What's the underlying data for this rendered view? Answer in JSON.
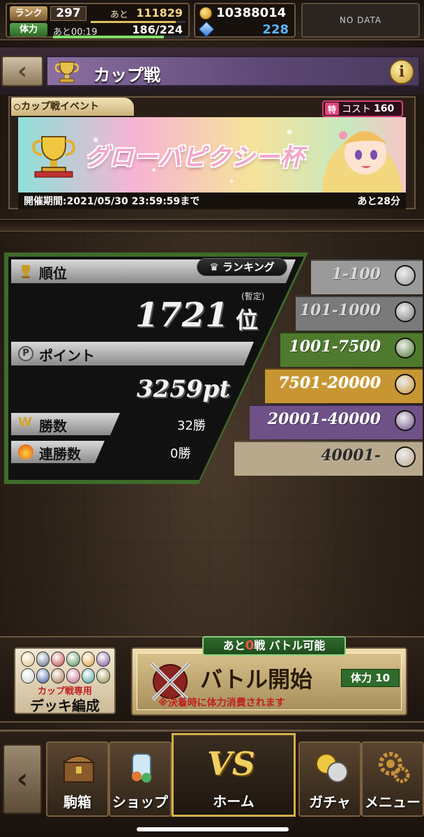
{
  "status": {
    "rank_label": "ランク",
    "rank_value": "297",
    "next_label": "あと",
    "next_value": "111829",
    "exp_fraction": 0.9,
    "stamina_label": "体力",
    "stamina_timer": "あと00:19",
    "stamina_value": "186/224",
    "stamina_fraction": 0.83,
    "coins": "10388014",
    "gems": "228",
    "nodata": "NO DATA"
  },
  "header": {
    "title": "カップ戦"
  },
  "banner": {
    "label": "カップ戦イベント",
    "cost_mark": "特",
    "cost_label": "コスト",
    "cost_value": "160",
    "event_name": "グローバピクシー杯",
    "period": "開催期間:2021/05/30 23:59:59まで",
    "time_left": "あと28分"
  },
  "stats": {
    "rank_label": "順位",
    "ranking_button": "ランキング",
    "provisional": "(暫定)",
    "rank_number": "1721",
    "rank_suffix": "位",
    "points_label": "ポイント",
    "points_value": "3259pt",
    "wins_label": "勝数",
    "wins_value": "32勝",
    "streak_label": "連勝数",
    "streak_value": "0勝"
  },
  "tiers": [
    {
      "range": "1-100",
      "color": "#9a9a9a"
    },
    {
      "range": "101-1000",
      "color": "#7a7a7a"
    },
    {
      "range": "1001-7500",
      "color": "#4f7a2e"
    },
    {
      "range": "7501-20000",
      "color": "#c79632"
    },
    {
      "range": "20001-40000",
      "color": "#6e5187"
    },
    {
      "range": "40001-",
      "color": "#b9a98c"
    }
  ],
  "battle": {
    "remaining_prefix": "あと",
    "remaining_count": "0",
    "remaining_suffix": "戦 バトル可能",
    "label": "バトル開始",
    "note": "※決着時に体力消費されます",
    "stamina_cost": "体力 10"
  },
  "deck": {
    "caption": "カップ戦専用",
    "title": "デッキ編成"
  },
  "nav": {
    "items": [
      {
        "label": "駒箱"
      },
      {
        "label": "ショップ"
      },
      {
        "label": "ホーム"
      },
      {
        "label": "ガチャ"
      },
      {
        "label": "メニュー"
      }
    ],
    "vs": "VS"
  }
}
